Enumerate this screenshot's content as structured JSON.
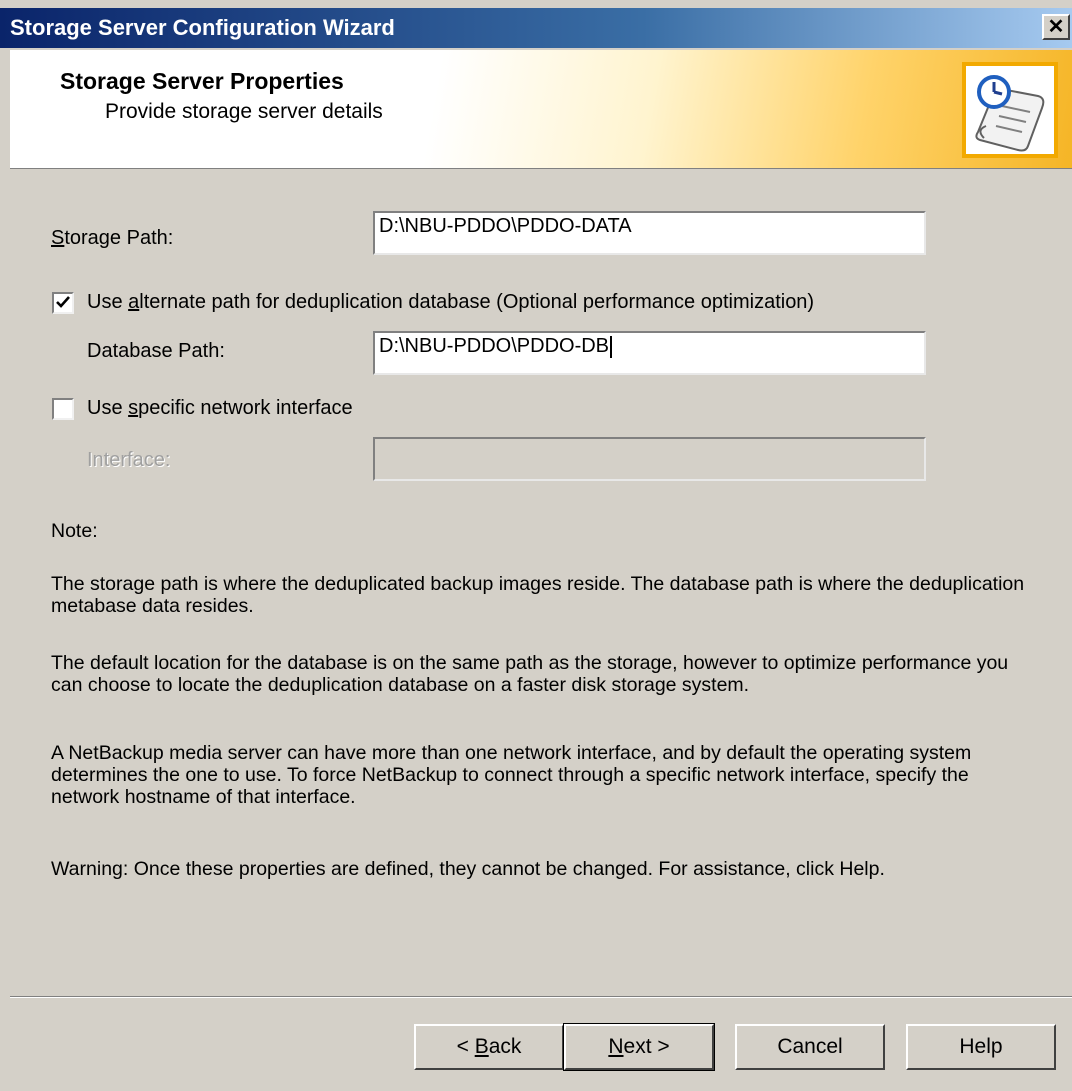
{
  "window": {
    "title": "Storage Server Configuration Wizard",
    "close_glyph": "✕"
  },
  "header": {
    "title": "Storage Server Properties",
    "subtitle": "Provide storage server details",
    "icon": "wizard-scroll-clock-icon"
  },
  "form": {
    "storage_path": {
      "label_prefix": "",
      "label_mnemonic": "S",
      "label_rest": "torage Path:",
      "value": "D:\\NBU-PDDO\\PDDO-DATA"
    },
    "alt_path_checkbox": {
      "checked": true,
      "label_prefix": "Use ",
      "label_mnemonic": "a",
      "label_rest": "lternate path for deduplication database (Optional performance optimization)"
    },
    "database_path": {
      "label": "Database Path:",
      "value": "D:\\NBU-PDDO\\PDDO-DB"
    },
    "network_checkbox": {
      "checked": false,
      "label_prefix": "Use ",
      "label_mnemonic": "s",
      "label_rest": "pecific network interface"
    },
    "interface": {
      "label": "Interface:",
      "value": ""
    }
  },
  "notes": {
    "heading": "Note:",
    "paragraphs": [
      "The storage path is where the deduplicated backup images reside. The database path is where the deduplication metabase data resides.",
      "The default location for the database is on the same path as the storage, however to optimize performance you can choose to locate the deduplication database on a faster disk storage system.",
      "A NetBackup media server can have more than one network interface, and by default the operating system determines the one to use. To force NetBackup to connect through a specific network interface, specify the network hostname of that interface.",
      "Warning: Once these properties are defined, they cannot be changed. For assistance, click Help."
    ]
  },
  "buttons": {
    "back": {
      "prefix": "< ",
      "mnemonic": "B",
      "rest": "ack"
    },
    "next": {
      "prefix": "",
      "mnemonic": "N",
      "rest": "ext >"
    },
    "cancel": "Cancel",
    "help": "Help"
  },
  "colors": {
    "dialog_bg": "#d4d0c8",
    "titlebar": "#0a246a",
    "header_accent": "#f5b526"
  }
}
